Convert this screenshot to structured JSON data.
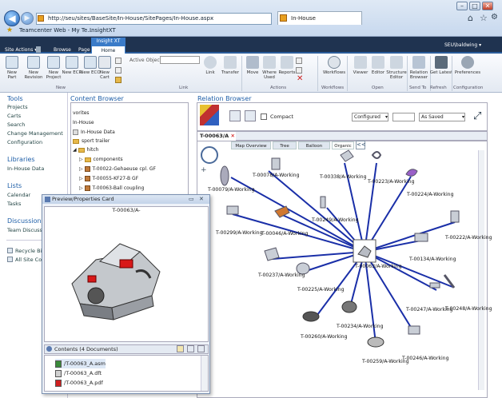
{
  "browser": {
    "address": "http://seu/sites/BaseSite/In-House/SitePages/In-House.aspx",
    "tab_label": "In-House",
    "fav1": "Teamcenter Web - My Te...",
    "fav2": "InsightXT"
  },
  "ribbon": {
    "site_actions": "Site Actions ▾",
    "tabs": [
      "Browse",
      "Page"
    ],
    "insight_group": "Insight XT",
    "home_tab": "Home",
    "user": "SEU\\baldwing ▾",
    "active_object_label": "Active Object:",
    "buttons": [
      {
        "label": "New Part"
      },
      {
        "label": "New Revision"
      },
      {
        "label": "New Project"
      },
      {
        "label": "New ECR"
      },
      {
        "label": "New ECO"
      },
      {
        "label": "New Cart"
      },
      {
        "label": "Link"
      },
      {
        "label": "Transfer"
      },
      {
        "label": "Move"
      },
      {
        "label": "Where Used"
      },
      {
        "label": "Reports"
      },
      {
        "label": "Workflows"
      },
      {
        "label": "Viewer"
      },
      {
        "label": "Editor"
      },
      {
        "label": "Structure Editor"
      },
      {
        "label": "Relation Browser"
      },
      {
        "label": "Get Latest"
      },
      {
        "label": "Preferences"
      }
    ],
    "groups": [
      "New",
      "Link",
      "Actions",
      "Workflows",
      "Open",
      "Send To",
      "Refresh",
      "Configuration"
    ]
  },
  "leftnav": {
    "tools": "Tools",
    "tool_items": [
      "Projects",
      "Carts",
      "Search",
      "Change Management",
      "Configuration"
    ],
    "libraries": "Libraries",
    "lib_items": [
      "In-House Data"
    ],
    "lists": "Lists",
    "list_items": [
      "Calendar",
      "Tasks"
    ],
    "discussions": "Discussions",
    "disc_items": [
      "Team Discuss"
    ],
    "bottom": [
      "Recycle Bi",
      "All Site Co"
    ]
  },
  "content_browser": {
    "title": "Content Browser",
    "items": [
      "vorites",
      "In-House",
      "In-House Data",
      "sport trailer",
      "hitch",
      "components",
      "T-00022-Gehaeuse cpl. GF",
      "T-00055-KF27-B GF",
      "T-00063-Ball coupling"
    ]
  },
  "relation": {
    "title": "Relation Browser",
    "compact": "Compact",
    "config": "Configured",
    "saved": "As Saved",
    "tab": "T-00063/A",
    "view_tabs": [
      "Map Overview",
      "Tree",
      "Balloon",
      "Organic"
    ],
    "nodes": [
      "T-00079/A-Working",
      "T-00078/A-Working",
      "T-00338/A-Working",
      "T-00223/A-Working",
      "T-00224/A-Working",
      "T-00249/A-Working",
      "T-00299/A-Working",
      "T-00046/A-Working",
      "T-00222/A-Working",
      "T-00134/A-Working",
      "T-00237/A-Working",
      "T-00225/A-Working",
      "T-00247/A-Working",
      "T-00248/A-Working",
      "T-00260/A-Working",
      "T-00234/A-Working",
      "T-00259/A-Working",
      "T-00246/A-Working",
      "T-00063/A-Working"
    ]
  },
  "card": {
    "title": "Preview/Properties Card",
    "object": "T-00063/A-",
    "contents": "Contents (4 Documents)",
    "docs": [
      "T-00063_A.asm",
      "T-00063_A.dft",
      "T-00063_A.pdf"
    ]
  }
}
